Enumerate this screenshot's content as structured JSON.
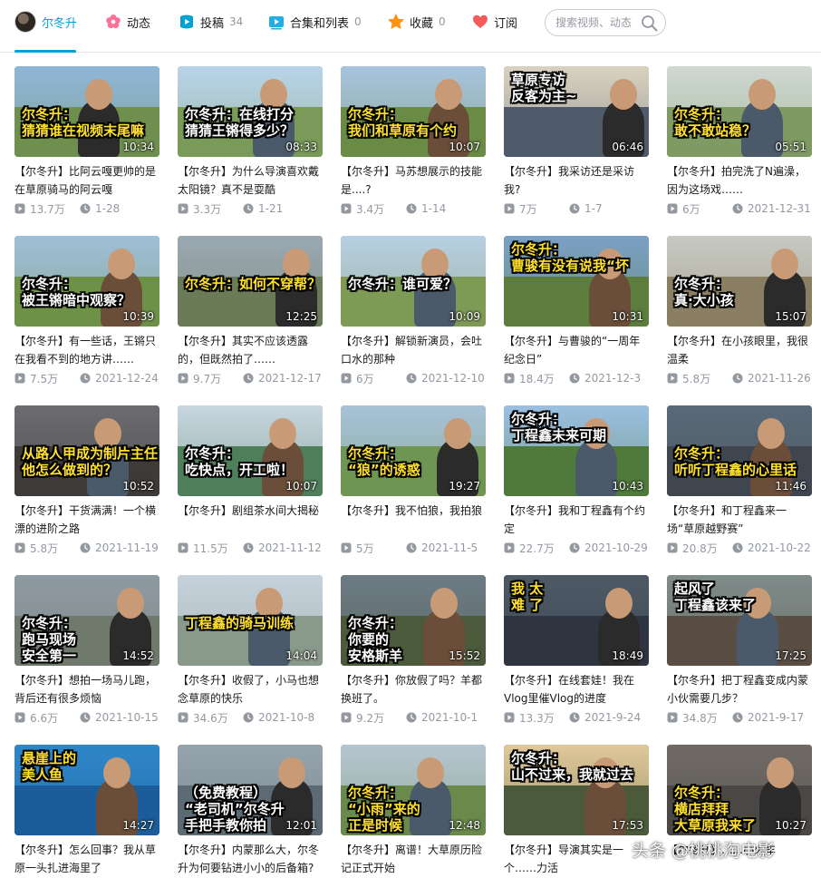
{
  "nav": {
    "user_name": "尔冬升",
    "tabs": [
      {
        "label": "动态",
        "icon": "flower-icon",
        "count": ""
      },
      {
        "label": "投稿",
        "icon": "video-icon",
        "count": "34"
      },
      {
        "label": "合集和列表",
        "icon": "playlist-icon",
        "count": "0"
      },
      {
        "label": "收藏",
        "icon": "star-icon",
        "count": "0"
      },
      {
        "label": "订阅",
        "icon": "heart-icon",
        "count": ""
      }
    ],
    "search_placeholder": "搜索视频、动态"
  },
  "colors": {
    "accent": "#00a1d6",
    "muted": "#9499a0",
    "caption_yellow": "#ffe02e",
    "caption_white": "#ffffff"
  },
  "videos": [
    {
      "title": "【尔冬升】比阿云嘎更帅的是在草原骑马的阿云嘎",
      "duration": "10:34",
      "views": "13.7万",
      "date": "1-28",
      "caption": "尔冬升：\n猜猜谁在视频末尾嘛"
    },
    {
      "title": "【尔冬升】为什么导演喜欢戴太阳镜？真不是耍酷",
      "duration": "08:33",
      "views": "3.3万",
      "date": "1-21",
      "caption": "尔冬升：在线打分\n猜猜王锵得多少？"
    },
    {
      "title": "【尔冬升】马苏想展示的技能是....?",
      "duration": "10:07",
      "views": "3.4万",
      "date": "1-14",
      "caption": "尔冬升：\n我们和草原有个约"
    },
    {
      "title": "【尔冬升】我采访还是采访我?",
      "duration": "06:46",
      "views": "7万",
      "date": "1-7",
      "caption": "草原专访\n反客为主~"
    },
    {
      "title": "【尔冬升】拍完洗了N遍澡，因为这场戏……",
      "duration": "05:51",
      "views": "6万",
      "date": "2021-12-31",
      "caption": "尔冬升：\n敢不敢站稳？"
    },
    {
      "title": "【尔冬升】有一些话，王锵只在我看不到的地方讲……",
      "duration": "10:39",
      "views": "7.5万",
      "date": "2021-12-24",
      "caption": "尔冬升：\n被王锵暗中观察？"
    },
    {
      "title": "【尔冬升】其实不应该透露的，但既然拍了……",
      "duration": "12:25",
      "views": "9.7万",
      "date": "2021-12-17",
      "caption": "尔冬升：如何不穿帮？"
    },
    {
      "title": "【尔冬升】解锁新演员，会吐口水的那种",
      "duration": "10:09",
      "views": "6万",
      "date": "2021-12-10",
      "caption": "尔冬升：谁可爱？"
    },
    {
      "title": "【尔冬升】与曹骏的“一周年纪念日”",
      "duration": "10:31",
      "views": "18.4万",
      "date": "2021-12-3",
      "caption": "尔冬升：\n曹骏有没有说我“坏"
    },
    {
      "title": "【尔冬升】在小孩眼里，我很温柔",
      "duration": "15:07",
      "views": "5.8万",
      "date": "2021-11-26",
      "caption": "尔冬升：\n真·大小孩"
    },
    {
      "title": "【尔冬升】干货满满！一个横漂的进阶之路",
      "duration": "10:52",
      "views": "5.8万",
      "date": "2021-11-19",
      "caption": "从路人甲成为制片主任\n他怎么做到的？"
    },
    {
      "title": "【尔冬升】剧组茶水间大揭秘",
      "duration": "10:07",
      "views": "11.5万",
      "date": "2021-11-12",
      "caption": "尔冬升：\n吃快点，开工啦！"
    },
    {
      "title": "【尔冬升】我不怕狼，我拍狼",
      "duration": "19:27",
      "views": "5万",
      "date": "2021-11-5",
      "caption": "尔冬升：\n“狼”的诱惑"
    },
    {
      "title": "【尔冬升】我和丁程鑫有个约定",
      "duration": "10:43",
      "views": "22.7万",
      "date": "2021-10-29",
      "caption": "尔冬升：\n丁程鑫未来可期"
    },
    {
      "title": "【尔冬升】和丁程鑫来一场“草原越野赛”",
      "duration": "11:46",
      "views": "20.8万",
      "date": "2021-10-22",
      "caption": "尔冬升：\n听听丁程鑫的心里话"
    },
    {
      "title": "【尔冬升】想拍一场马儿跑，背后还有很多烦恼",
      "duration": "14:52",
      "views": "6.6万",
      "date": "2021-10-15",
      "caption": "尔冬升：\n跑马现场\n安全第一"
    },
    {
      "title": "【尔冬升】收假了，小马也想念草原的快乐",
      "duration": "14:04",
      "views": "34.6万",
      "date": "2021-10-8",
      "caption": "丁程鑫的骑马训练"
    },
    {
      "title": "【尔冬升】你放假了吗？羊都换班了。",
      "duration": "15:52",
      "views": "9.2万",
      "date": "2021-10-1",
      "caption": "尔冬升：\n你要的\n安格斯羊"
    },
    {
      "title": "【尔冬升】在线套娃！我在Vlog里催Vlog的进度",
      "duration": "18:49",
      "views": "13.3万",
      "date": "2021-9-24",
      "caption": "我  太\n难  了"
    },
    {
      "title": "【尔冬升】把丁程鑫变成内蒙小伙需要几步？",
      "duration": "17:25",
      "views": "34.8万",
      "date": "2021-9-17",
      "caption": "起风了\n丁程鑫该来了"
    },
    {
      "title": "【尔冬升】怎么回事？我从草原一头扎进海里了",
      "duration": "14:27",
      "views": "",
      "date": "",
      "caption": "悬崖上的\n美人鱼"
    },
    {
      "title": "【尔冬升】内蒙那么大，尔冬升为何要钻进小小的后备箱?",
      "duration": "12:01",
      "views": "",
      "date": "",
      "caption": "（免费教程）\n“老司机”尔冬升\n手把手教你拍"
    },
    {
      "title": "【尔冬升】离谱！大草原历险记正式开始",
      "duration": "12:48",
      "views": "",
      "date": "",
      "caption": "尔冬升：\n“小雨”来的\n正是时候"
    },
    {
      "title": "【尔冬升】导演其实是一个……力活",
      "duration": "17:53",
      "views": "",
      "date": "",
      "caption": "尔冬升：\n山不过来，我就过去"
    },
    {
      "title": "【尔冬升】……小火车",
      "duration": "10:27",
      "views": "",
      "date": "",
      "caption": "尔冬升：\n横店拜拜\n大草原我来了"
    }
  ],
  "watermark": "头条 @桃桃淘电影"
}
